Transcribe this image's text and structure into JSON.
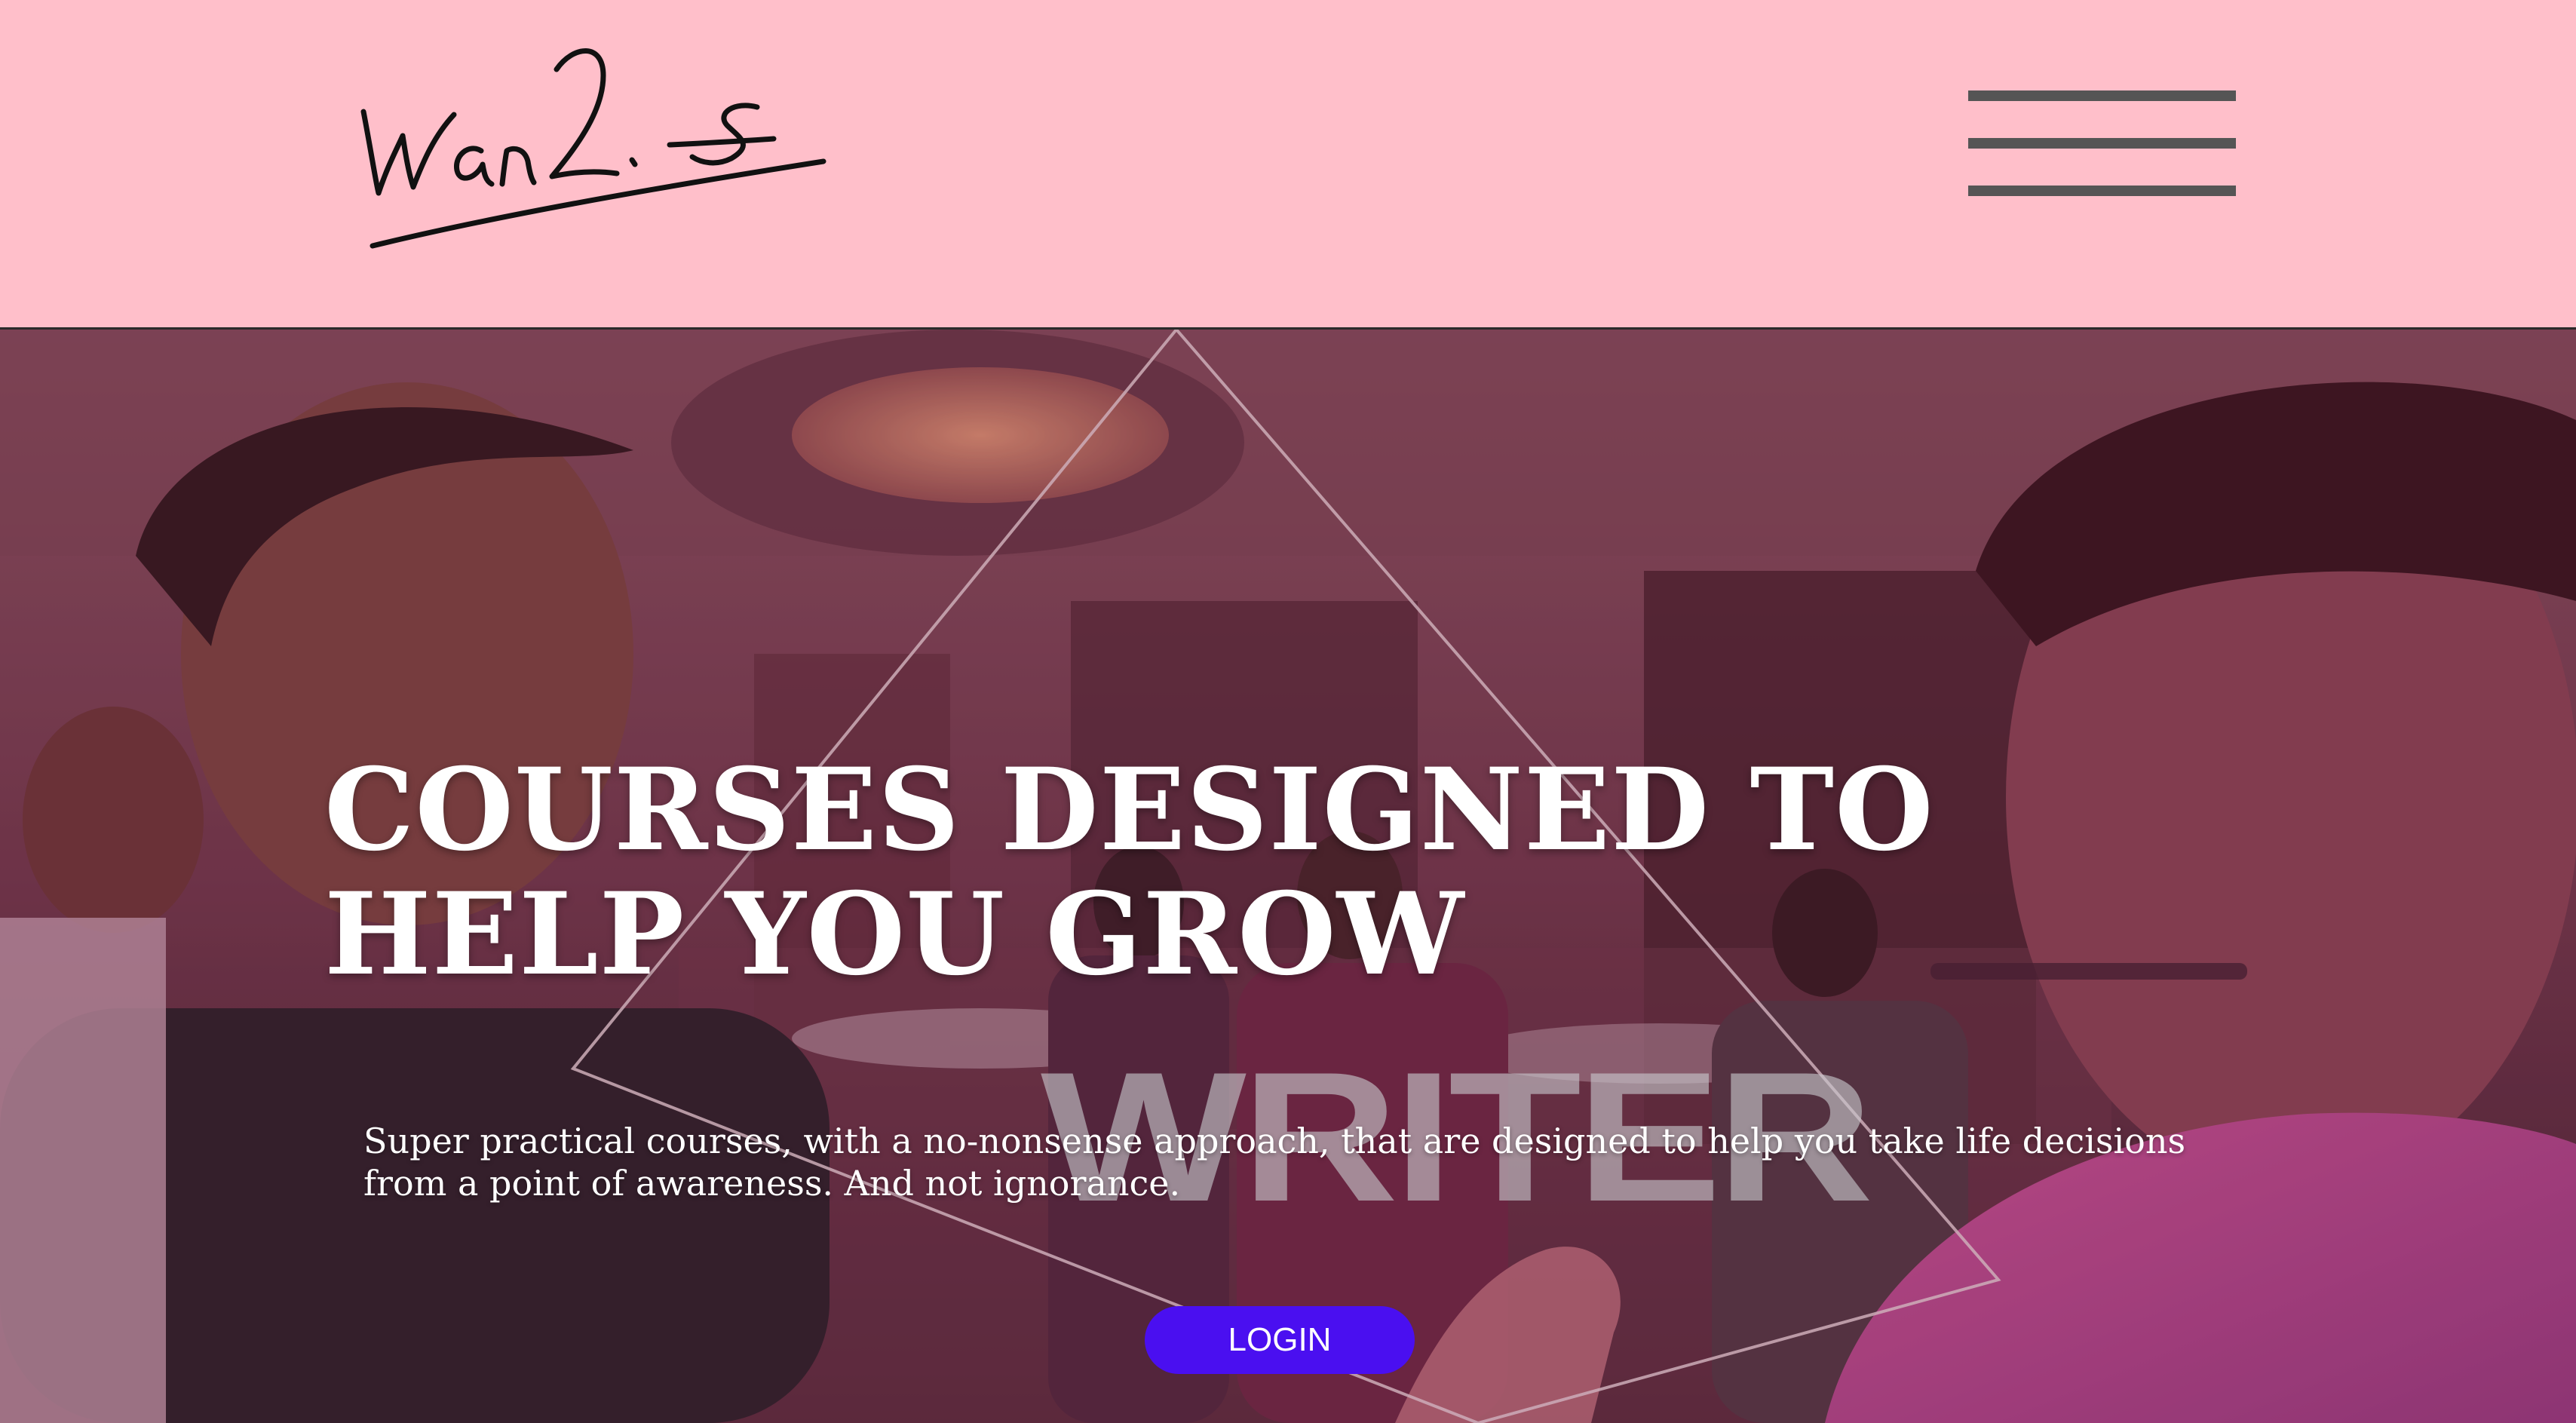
{
  "header": {
    "logo_signature": "Wan2. S",
    "menu_icon": "hamburger-menu-icon"
  },
  "hero": {
    "background_description_icon": "conference-photo-background",
    "title": "COURSES DESIGNED TO HELP YOU GROW",
    "watermark": "WRITER",
    "subtitle": "Super practical courses, with a no-nonsense approach, that are designed to help you take life decisions from a point of awareness. And not ignorance.",
    "login_label": "LOGIN"
  },
  "colors": {
    "header_background": "#ffbfca",
    "login_button": "#4a0ff0",
    "menu_lines": "#555555",
    "hero_text": "#ffffff"
  }
}
